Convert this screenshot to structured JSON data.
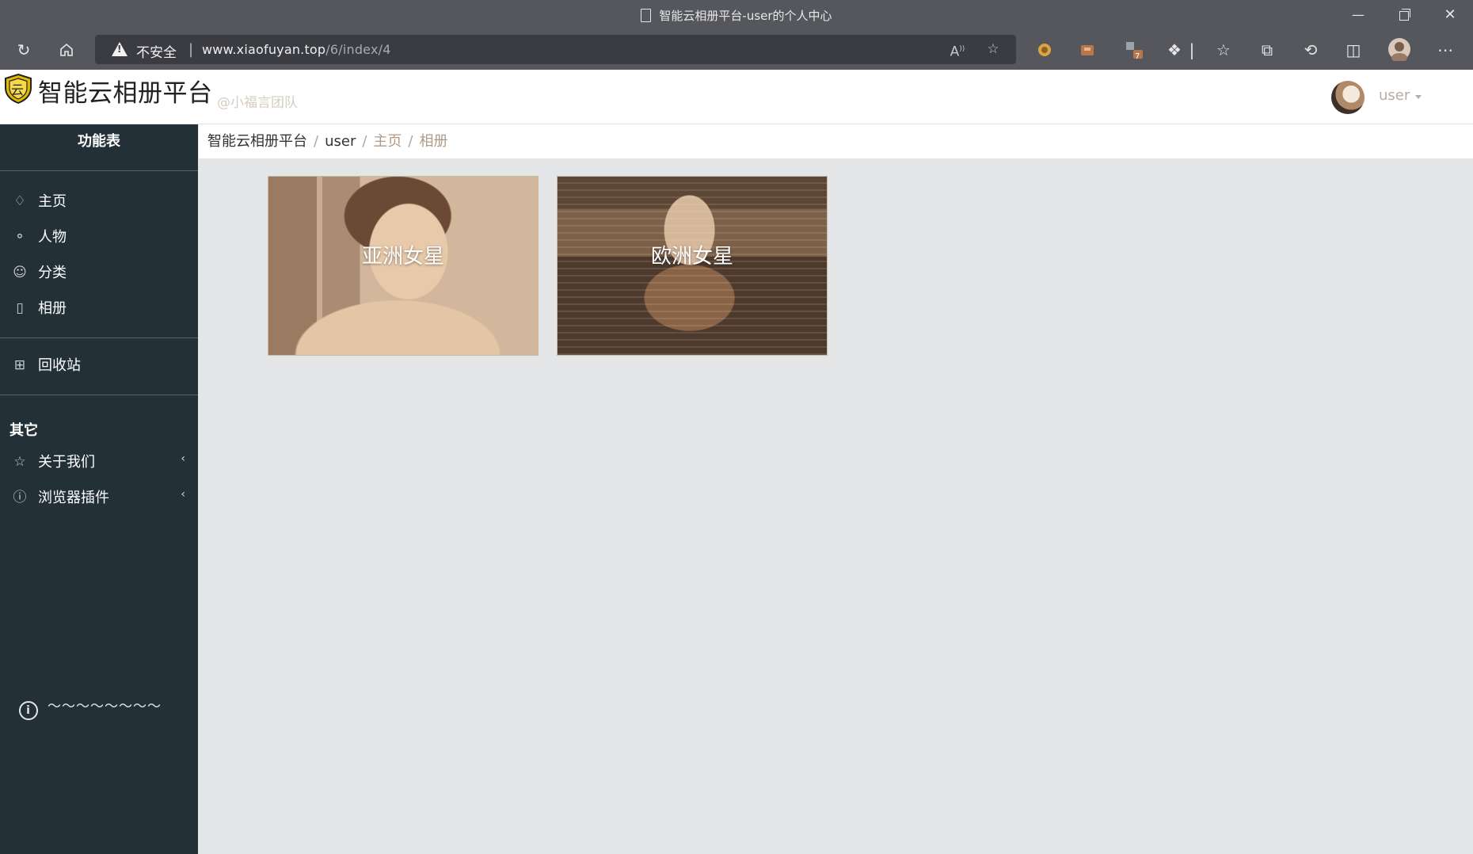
{
  "browser": {
    "tab_title": "智能云相册平台-user的个人中心",
    "address": {
      "security_label": "不安全",
      "url_host": "www.xiaofuyan.top",
      "url_path": "/6/index/4"
    },
    "extension_badge": "7"
  },
  "header": {
    "logo_badge_text": "云",
    "title": "智能云相册平台",
    "subtitle": "@小福言团队",
    "user_name": "user"
  },
  "sidebar": {
    "heading": "功能表",
    "main_items": [
      {
        "label": "主页",
        "icon": "tag-icon"
      },
      {
        "label": "人物",
        "icon": "person-icon"
      },
      {
        "label": "分类",
        "icon": "smile-icon"
      },
      {
        "label": "相册",
        "icon": "book-icon"
      }
    ],
    "recycle": {
      "label": "回收站",
      "icon": "calculator-icon"
    },
    "other_heading": "其它",
    "other_items": [
      {
        "label": "关于我们",
        "icon": "star-icon",
        "arrow": "‹"
      },
      {
        "label": "浏览器插件",
        "icon": "info-icon",
        "arrow": "‹"
      }
    ],
    "footnote": "～～～～～～～～"
  },
  "breadcrumb": {
    "items": [
      "智能云相册平台",
      "user",
      "主页",
      "相册"
    ],
    "separator": "/"
  },
  "albums": [
    {
      "label": "亚洲女星"
    },
    {
      "label": "欧洲女星"
    }
  ],
  "colors": {
    "sidebar_bg": "#233038",
    "browser_chrome": "#55575d",
    "content_bg": "#e4e5e7",
    "breadcrumb_muted": "#b19a85"
  }
}
